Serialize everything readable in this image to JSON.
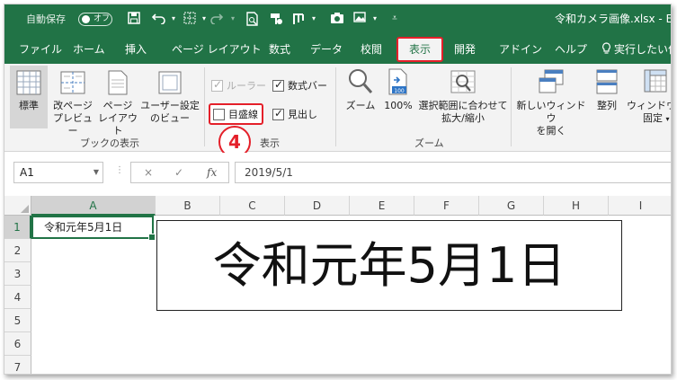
{
  "titlebar": {
    "autosave_label": "自動保存",
    "autosave_state": "オフ",
    "doc_title": "令和カメラ画像.xlsx - Ex",
    "icons": [
      "save-icon",
      "undo-icon",
      "borders-icon",
      "redo-icon",
      "print-preview-icon",
      "format-painter-icon",
      "pivot-icon",
      "camera-icon",
      "picture-icon",
      "customize-icon"
    ]
  },
  "tabs": [
    "ファイル",
    "ホーム",
    "挿入",
    "ページ レイアウト",
    "数式",
    "データ",
    "校閲",
    "表示",
    "開発",
    "アドイン",
    "ヘルプ",
    "実行したい作"
  ],
  "active_tab": "表示",
  "ribbon": {
    "views": {
      "normal": "標準",
      "page_break_1": "改ページ",
      "page_break_2": "プレビュー",
      "page_layout_1": "ページ",
      "page_layout_2": "レイアウト",
      "custom_1": "ユーザー設定",
      "custom_2": "のビュー",
      "group_label": "ブックの表示"
    },
    "show": {
      "ruler": "ルーラー",
      "formula_bar": "数式バー",
      "gridlines": "目盛線",
      "headings": "見出し",
      "group_label": "表示",
      "ruler_checked": true,
      "formula_bar_checked": true,
      "gridlines_checked": false,
      "headings_checked": true
    },
    "zoom": {
      "zoom": "ズーム",
      "hundred": "100%",
      "fit_1": "選択範囲に合わせて",
      "fit_2": "拡大/縮小",
      "group_label": "ズーム"
    },
    "window": {
      "new_window_1": "新しいウィンドウ",
      "new_window_2": "を開く",
      "arrange": "整列",
      "freeze_1": "ウィンドウ枠",
      "freeze_2": "固定"
    }
  },
  "step_badge": "4",
  "formula_bar": {
    "name_box": "A1",
    "cancel": "×",
    "enter": "✓",
    "fx": "fx",
    "value": "2019/5/1"
  },
  "grid": {
    "columns": [
      "A",
      "B",
      "C",
      "D",
      "E",
      "F",
      "G",
      "H",
      "I"
    ],
    "rows": [
      "1",
      "2",
      "3",
      "4",
      "5",
      "6",
      "7"
    ],
    "a1_value": "令和元年5月1日",
    "picture_text": "令和元年5月1日"
  },
  "colors": {
    "excel_green": "#217346",
    "highlight_red": "#e4202a"
  }
}
